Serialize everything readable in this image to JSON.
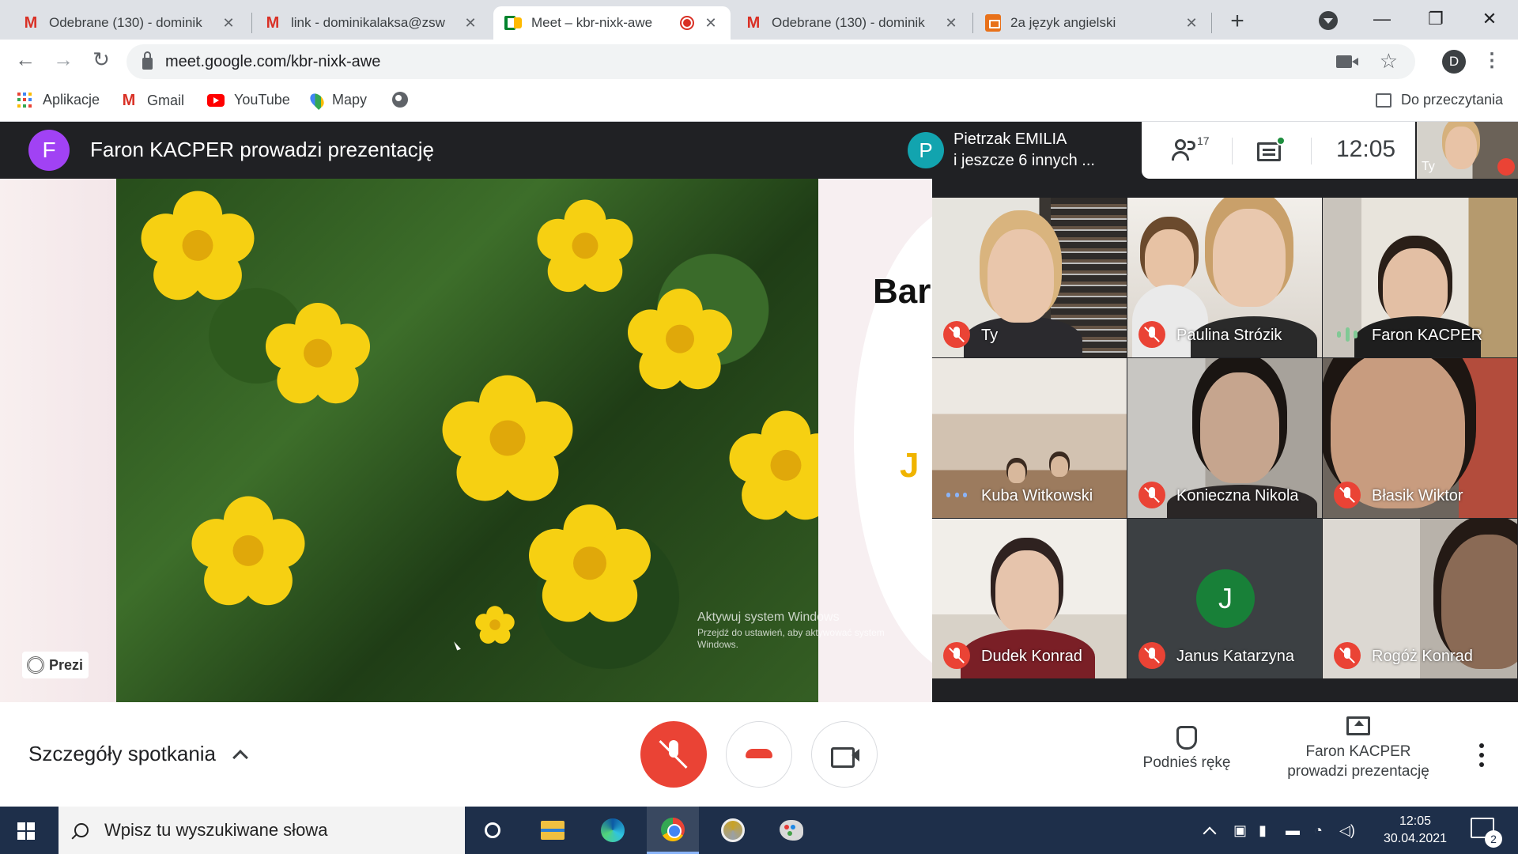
{
  "browser": {
    "tabs": [
      {
        "title": "Odebrane (130) - dominik",
        "icon": "gmail-icon",
        "active": false
      },
      {
        "title": "link - dominikalaksa@zsw",
        "icon": "gmail-icon",
        "active": false
      },
      {
        "title": "Meet – kbr-nixk-awe",
        "icon": "meet-icon",
        "active": true,
        "recording": true
      },
      {
        "title": "Odebrane (130) - dominik",
        "icon": "gmail-icon",
        "active": false
      },
      {
        "title": "2a język angielski",
        "icon": "slides-icon",
        "active": false
      }
    ],
    "new_tab": "+",
    "url": "meet.google.com/kbr-nixk-awe",
    "profile_initial": "D",
    "bookmarks": [
      "Aplikacje",
      "Gmail",
      "YouTube",
      "Mapy"
    ],
    "reading_list": "Do przeczytania"
  },
  "meet": {
    "presenter_initial": "F",
    "presenting_title": "Faron KACPER prowadzi prezentację",
    "active_speaker": {
      "initial": "P",
      "line1": "Pietrzak EMILIA",
      "line2": "i jeszcze 6 innych ..."
    },
    "people_count": "17",
    "time": "12:05",
    "self_label": "Ty",
    "slide": {
      "heading": "Bar",
      "subtext": "J",
      "prezi_label": "Prezi",
      "watermark_title": "Aktywuj system Windows",
      "watermark_body": "Przejdź do ustawień, aby aktywować system Windows."
    },
    "participants": [
      {
        "name": "Ty",
        "status": "muted"
      },
      {
        "name": "Paulina Strózik",
        "status": "muted"
      },
      {
        "name": "Faron KACPER",
        "status": "speaking"
      },
      {
        "name": "Kuba Witkowski",
        "status": "idle"
      },
      {
        "name": "Konieczna Nikola",
        "status": "muted"
      },
      {
        "name": "Błasik Wiktor",
        "status": "muted"
      },
      {
        "name": "Dudek Konrad",
        "status": "muted"
      },
      {
        "name": "Janus Katarzyna",
        "status": "muted",
        "avatar": "J"
      },
      {
        "name": "Rogóż Konrad",
        "status": "muted"
      }
    ],
    "controls": {
      "details": "Szczegóły spotkania",
      "raise_hand": "Podnieś rękę",
      "present_line1": "Faron KACPER",
      "present_line2": "prowadzi prezentację"
    }
  },
  "taskbar": {
    "search_placeholder": "Wpisz tu wyszukiwane słowa",
    "time": "12:05",
    "date": "30.04.2021",
    "notifications": "2"
  },
  "colors": {
    "meet_dark": "#202124",
    "mute_red": "#ea4335",
    "presenter_purple": "#a142f4",
    "speaker_teal": "#12a4af",
    "avatar_green": "#188038",
    "taskbar": "#1e2f4a"
  }
}
